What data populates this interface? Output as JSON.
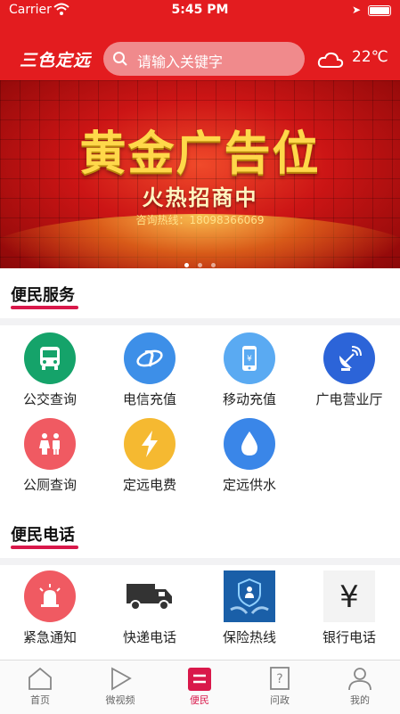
{
  "status_bar": {
    "carrier": "Carrier",
    "time": "5:45 PM"
  },
  "header": {
    "logo": "三色定远",
    "search_placeholder": "请输入关键字",
    "temperature": "22℃",
    "weather_icon": "cloud-icon"
  },
  "banner": {
    "headline": "黄金广告位",
    "subheadline": "火热招商中",
    "hotline": "咨询热线：18098366069",
    "slide_count": 3,
    "active_slide": 1
  },
  "services": {
    "title": "便民服务",
    "items": [
      {
        "label": "公交查询",
        "icon": "bus-icon",
        "color": "#15a36a"
      },
      {
        "label": "电信充值",
        "icon": "telecom-icon",
        "color": "#3d8fe8"
      },
      {
        "label": "移动充值",
        "icon": "mobile-phone-icon",
        "color": "#5aaaf2"
      },
      {
        "label": "广电营业厅",
        "icon": "satellite-dish-icon",
        "color": "#2c64d8"
      },
      {
        "label": "公厕查询",
        "icon": "restroom-icon",
        "color": "#f05a62"
      },
      {
        "label": "定远电费",
        "icon": "lightning-icon",
        "color": "#f5b931"
      },
      {
        "label": "定远供水",
        "icon": "water-drop-icon",
        "color": "#3a86e8"
      }
    ]
  },
  "phones": {
    "title": "便民电话",
    "items": [
      {
        "label": "紧急通知",
        "icon": "alarm-light-icon",
        "color": "#f05a62"
      },
      {
        "label": "快递电话",
        "icon": "delivery-truck-icon",
        "color": "#333333"
      },
      {
        "label": "保险热线",
        "icon": "insurance-shield-icon",
        "color": "#1a5fa8"
      },
      {
        "label": "银行电话",
        "icon": "yen-icon",
        "color": "#222222"
      }
    ]
  },
  "tabbar": {
    "tabs": [
      {
        "label": "首页",
        "icon": "home-icon"
      },
      {
        "label": "微视频",
        "icon": "play-icon"
      },
      {
        "label": "便民",
        "icon": "service-icon",
        "active": true
      },
      {
        "label": "问政",
        "icon": "question-doc-icon"
      },
      {
        "label": "我的",
        "icon": "user-icon"
      }
    ],
    "active_color": "#d9184a"
  }
}
